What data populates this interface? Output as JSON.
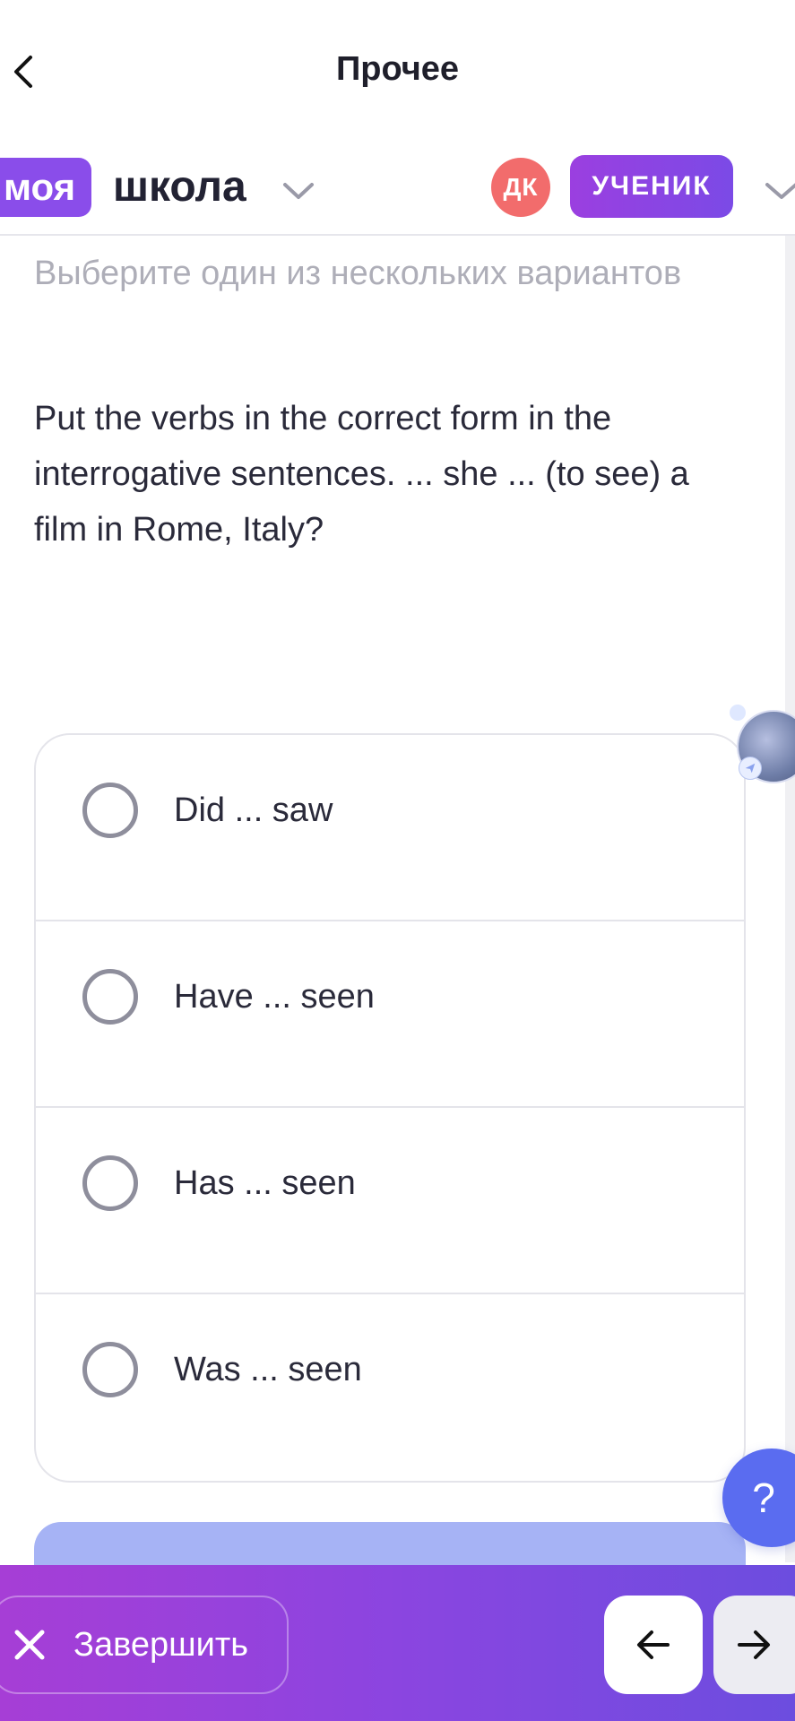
{
  "nav": {
    "title": "Прочее"
  },
  "brand": {
    "logo_part1": "моя",
    "logo_part2": "школа"
  },
  "user": {
    "initials": "ДК",
    "role": "УЧЕНИК"
  },
  "task": {
    "instruction": "Выберите один из нескольких вариантов",
    "question": "Put the verbs in the correct form in the interrogative sentences. ... she ... (to see) a film in Rome, Italy?",
    "options": [
      {
        "label": "Did ... saw"
      },
      {
        "label": "Have ... seen"
      },
      {
        "label": "Has ... seen"
      },
      {
        "label": "Was ... seen"
      }
    ]
  },
  "help": {
    "label": "?"
  },
  "bottom": {
    "finish_label": "Завершить"
  },
  "colors": {
    "accent": "#8a4dea",
    "avatar": "#f26c6c",
    "help": "#5a6cf0",
    "submit": "#a6b3f5"
  }
}
